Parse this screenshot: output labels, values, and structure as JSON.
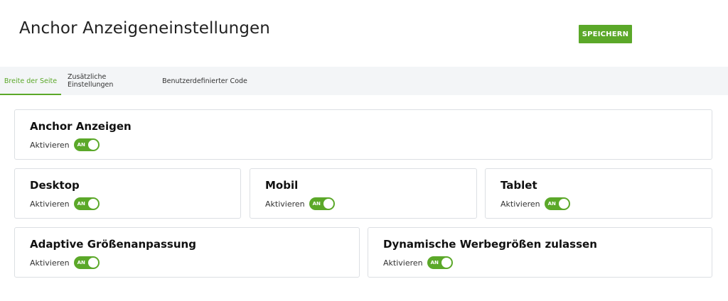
{
  "header": {
    "title": "Anchor Anzeigeneinstellungen",
    "save_label": "SPEICHERN"
  },
  "tabs": [
    {
      "label": "Breite der Seite",
      "active": true
    },
    {
      "label": "Zusätzliche Einstellungen",
      "active": false
    },
    {
      "label": "Benutzerdefinierter Code",
      "active": false
    }
  ],
  "toggle_label": "Aktivieren",
  "toggle_state": "AN",
  "cards": {
    "anchor": {
      "title": "Anchor Anzeigen",
      "enabled": true
    },
    "desktop": {
      "title": "Desktop",
      "enabled": true
    },
    "mobile": {
      "title": "Mobil",
      "enabled": true
    },
    "tablet": {
      "title": "Tablet",
      "enabled": true
    },
    "adaptive": {
      "title": "Adaptive Größenanpassung",
      "enabled": true
    },
    "dynamic": {
      "title": "Dynamische Werbegrößen zulassen",
      "enabled": true
    }
  },
  "colors": {
    "accent": "#5ba829",
    "tabbar_bg": "#f3f5f7",
    "border": "#dcdfe3"
  }
}
